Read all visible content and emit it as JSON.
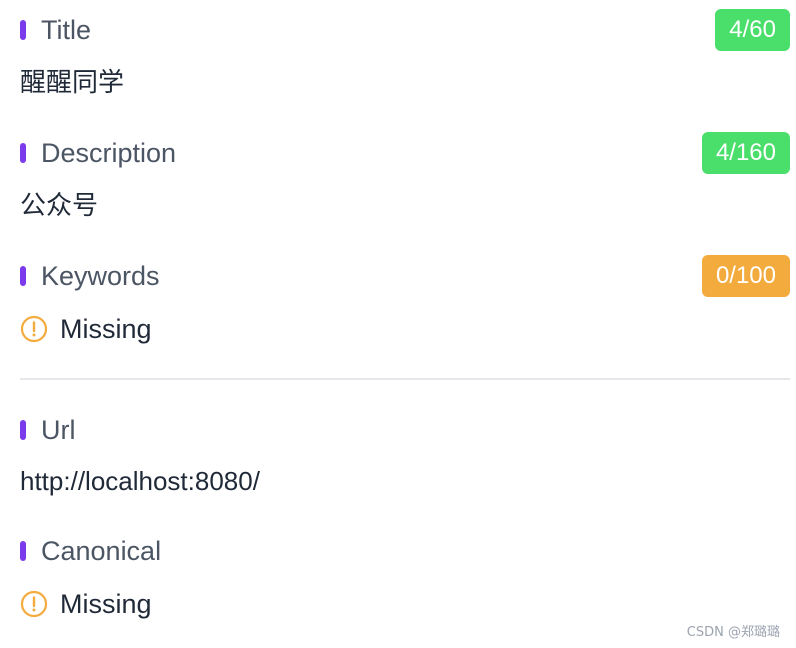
{
  "fields": {
    "title": {
      "label": "Title",
      "count": "4/60",
      "value": "醒醒同学"
    },
    "description": {
      "label": "Description",
      "count": "4/160",
      "value": "公众号"
    },
    "keywords": {
      "label": "Keywords",
      "count": "0/100",
      "missing": "Missing"
    },
    "url": {
      "label": "Url",
      "value": "http://localhost:8080/"
    },
    "canonical": {
      "label": "Canonical",
      "missing": "Missing"
    }
  },
  "watermark": "CSDN @郑璐璐",
  "colors": {
    "accent": "#7c3aed",
    "badge_ok": "#4ade6a",
    "badge_warn": "#f2ab3c",
    "warning_icon": "#f2ab3c"
  },
  "icons": {
    "warning": "exclamation-circle-icon"
  }
}
